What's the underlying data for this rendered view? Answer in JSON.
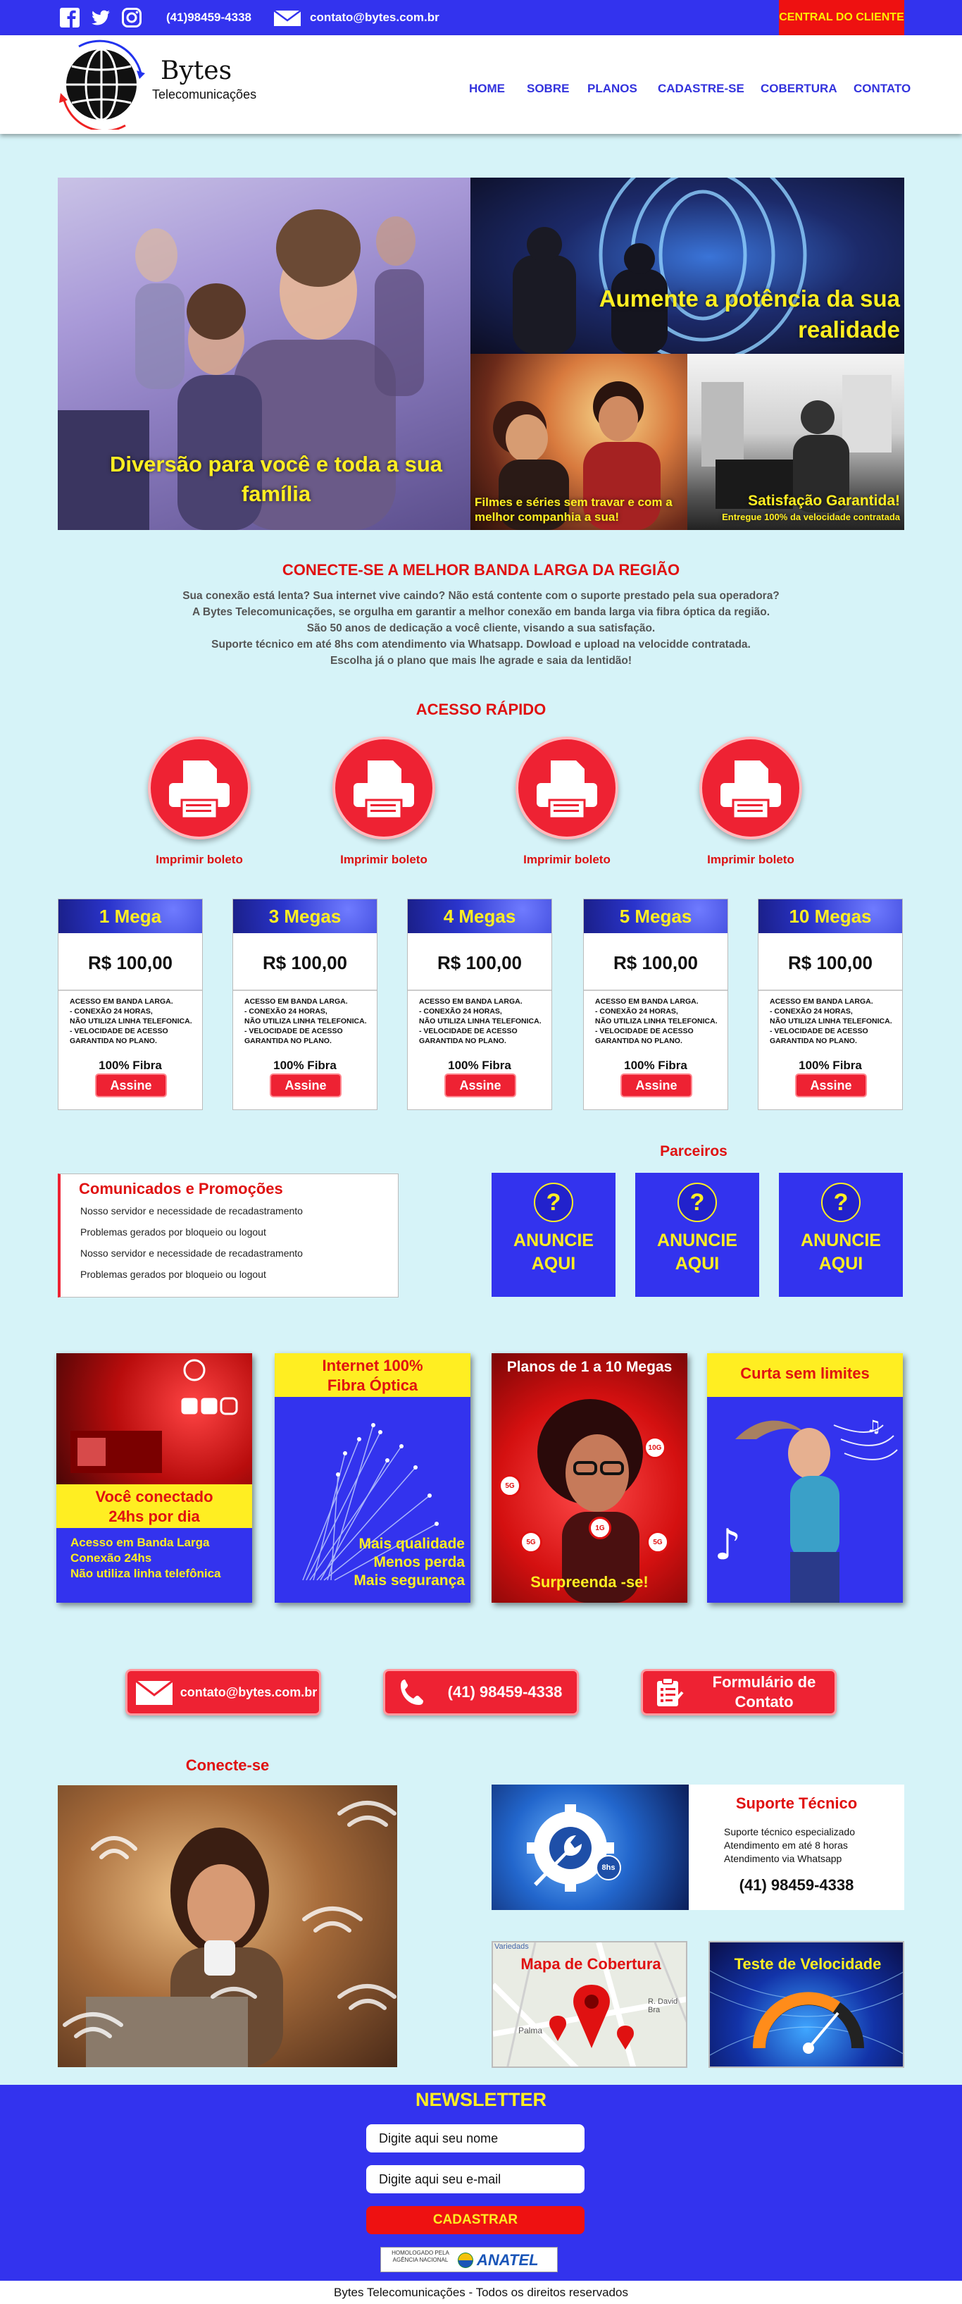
{
  "topbar": {
    "icons": [
      "facebook-icon",
      "twitter-icon",
      "instagram-icon",
      "envelope-icon"
    ],
    "phone": "(41)98459-4338",
    "email": "contato@bytes.com.br",
    "central": "CENTRAL DO CLIENTE"
  },
  "header": {
    "logo_title": "Bytes",
    "logo_subtitle": "Telecomunicações",
    "nav": [
      "HOME",
      "SOBRE",
      "PLANOS",
      "CADASTRE-SE",
      "COBERTURA",
      "CONTATO"
    ]
  },
  "hero": {
    "left_text": "Diversão para você e toda a sua família",
    "top_right_text": "Aumente a potência da sua realidade",
    "bottom_left_text": "Filmes e séries sem travar e com a melhor companhia a sua!",
    "bottom_right_title": "Satisfação Garantida!",
    "bottom_right_sub": "Entregue 100% da velocidade contratada"
  },
  "intro": {
    "title": "CONECTE-SE A MELHOR BANDA LARGA DA REGIÃO",
    "lines": [
      "Sua conexão está lenta? Sua internet vive caindo? Não está contente com o suporte prestado pela sua operadora?",
      "A Bytes Telecomunicações, se orgulha em garantir a melhor conexão em banda larga via fibra óptica da região.",
      "São 50 anos de dedicação a você cliente, visando a sua satisfação.",
      "Suporte técnico em até 8hs com atendimento via Whatsapp.  Dowload e upload na velocidde contratada.",
      "Escolha já o plano que mais lhe agrade e saia da lentidão!"
    ]
  },
  "quick_access": {
    "title": "ACESSO RÁPIDO",
    "items": [
      "Imprimir boleto",
      "Imprimir boleto",
      "Imprimir boleto",
      "Imprimir boleto"
    ]
  },
  "plans": [
    {
      "name": "1 Mega",
      "price": "R$ 100,00",
      "desc": "ACESSO EM BANDA LARGA.\n- CONEXÃO 24 HORAS,\nNÃO UTILIZA LINHA TELEFONICA.\n- VELOCIDADE DE ACESSO\nGARANTIDA NO PLANO.",
      "fibra": "100% Fibra",
      "button": "Assine"
    },
    {
      "name": "3 Megas",
      "price": "R$ 100,00",
      "desc": "ACESSO EM BANDA LARGA.\n- CONEXÃO 24 HORAS,\nNÃO UTILIZA LINHA TELEFONICA.\n- VELOCIDADE DE ACESSO\nGARANTIDA NO PLANO.",
      "fibra": "100% Fibra",
      "button": "Assine"
    },
    {
      "name": "4 Megas",
      "price": "R$ 100,00",
      "desc": "ACESSO EM BANDA LARGA.\n- CONEXÃO 24 HORAS,\nNÃO UTILIZA LINHA TELEFONICA.\n- VELOCIDADE DE ACESSO\nGARANTIDA NO PLANO.",
      "fibra": "100% Fibra",
      "button": "Assine"
    },
    {
      "name": "5 Megas",
      "price": "R$ 100,00",
      "desc": "ACESSO EM BANDA LARGA.\n- CONEXÃO 24 HORAS,\nNÃO UTILIZA LINHA TELEFONICA.\n- VELOCIDADE DE ACESSO\nGARANTIDA NO PLANO.",
      "fibra": "100% Fibra",
      "button": "Assine"
    },
    {
      "name": "10 Megas",
      "price": "R$ 100,00",
      "desc": "ACESSO EM BANDA LARGA.\n- CONEXÃO 24 HORAS,\nNÃO UTILIZA LINHA TELEFONICA.\n- VELOCIDADE DE ACESSO\nGARANTIDA NO PLANO.",
      "fibra": "100% Fibra",
      "button": "Assine"
    }
  ],
  "comunicados": {
    "title": "Comunicados e Promoções",
    "items": [
      "Nosso servidor e necessidade de recadastramento",
      "Problemas gerados por bloqueio ou logout",
      "Nosso servidor e necessidade de recadastramento",
      "Problemas gerados por bloqueio ou logout"
    ]
  },
  "parceiros": {
    "title": "Parceiros",
    "ads": [
      "ANUNCIE AQUI",
      "ANUNCIE AQUI",
      "ANUNCIE AQUI"
    ],
    "ad_mark": "?"
  },
  "promos": {
    "p1": {
      "title": "Você conectado 24hs por dia",
      "lines": [
        "Acesso em Banda Larga",
        "Conexão 24hs",
        "Não utiliza linha telefônica"
      ]
    },
    "p2": {
      "title": "Internet 100% Fibra Óptica",
      "lines": [
        "Mais qualidade",
        "Menos perda",
        "Mais segurança"
      ]
    },
    "p3": {
      "title": "Planos de 1 a 10 Megas",
      "bottom": "Surpreenda -se!",
      "badges": [
        "10G",
        "5G",
        "1G",
        "5G",
        "5G"
      ]
    },
    "p4": {
      "title": "Curta sem limites"
    }
  },
  "contact_buttons": {
    "email": "contato@bytes.com.br",
    "phone": "(41) 98459-4338",
    "form": "Formulário de Contato"
  },
  "conecte": {
    "title": "Conecte-se"
  },
  "support": {
    "title": "Suporte Técnico",
    "lines": [
      "Suporte técnico especializado",
      "Atendimento em até 8 horas",
      "Atendimento via Whatsapp"
    ],
    "phone": "(41) 98459-4338",
    "badge": "8hs"
  },
  "map": {
    "title": "Mapa de Cobertura",
    "labels": [
      "Variedads",
      "Palma",
      "R. David Bra"
    ]
  },
  "speed": {
    "title": "Teste de Velocidade"
  },
  "newsletter": {
    "title": "NEWSLETTER",
    "name_placeholder": "Digite aqui seu nome",
    "email_placeholder": "Digite aqui seu e-mail",
    "button": "CADASTRAR",
    "anatel_small": "HOMOLOGADO PELA AGÊNCIA NACIONAL",
    "anatel": "ANATEL"
  },
  "footer": "Bytes Telecomunicações - Todos os direitos reservados",
  "colors": {
    "primary_blue": "#3333ee",
    "accent_red": "#ee2233",
    "highlight_yellow": "#ffee22",
    "background": "#d6f3f8"
  }
}
